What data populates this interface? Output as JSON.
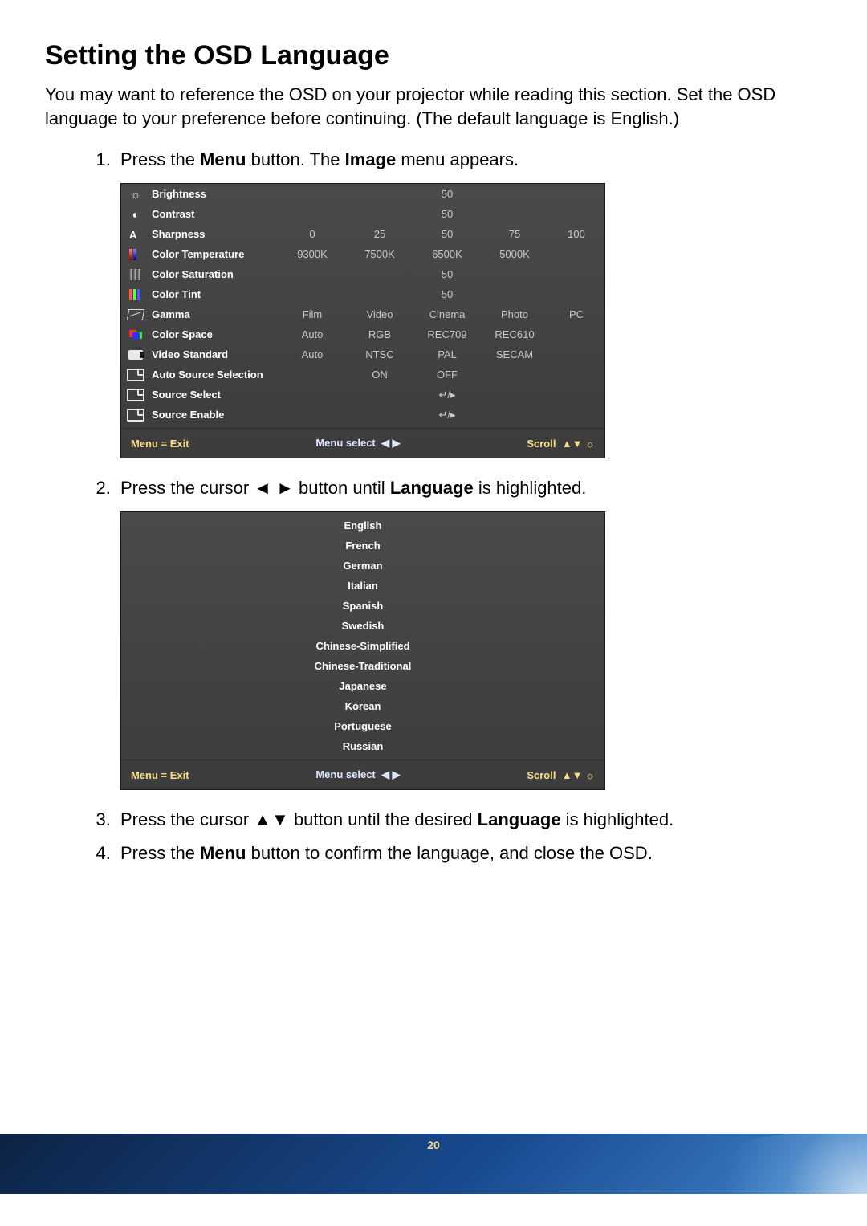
{
  "title": "Setting the OSD Language",
  "intro": "You may want to reference the OSD on your projector while reading this section. Set the OSD language to your preference before continuing. (The default language is English.)",
  "steps": {
    "s1_pre": "Press the ",
    "s1_b1": "Menu",
    "s1_mid": " button. The ",
    "s1_b2": "Image",
    "s1_post": " menu appears.",
    "s2_pre": "Press the cursor ◄ ► button until ",
    "s2_b": "Language",
    "s2_post": " is highlighted.",
    "s3_pre": "Press the cursor ▲▼ button until the desired ",
    "s3_b": "Language",
    "s3_post": " is highlighted.",
    "s4_pre": "Press the ",
    "s4_b": "Menu",
    "s4_post": " button to confirm the language, and close the OSD."
  },
  "osd": {
    "footer_exit": "Menu = Exit",
    "footer_select": "Menu select",
    "footer_scroll": "Scroll",
    "rows": [
      {
        "label": "Brightness",
        "cols": [
          "",
          "",
          "50",
          "",
          ""
        ]
      },
      {
        "label": "Contrast",
        "cols": [
          "",
          "",
          "50",
          "",
          ""
        ]
      },
      {
        "label": "Sharpness",
        "cols": [
          "0",
          "25",
          "50",
          "75",
          "100"
        ]
      },
      {
        "label": "Color Temperature",
        "cols": [
          "9300K",
          "7500K",
          "6500K",
          "5000K",
          ""
        ]
      },
      {
        "label": "Color Saturation",
        "cols": [
          "",
          "",
          "50",
          "",
          ""
        ]
      },
      {
        "label": "Color Tint",
        "cols": [
          "",
          "",
          "50",
          "",
          ""
        ]
      },
      {
        "label": "Gamma",
        "cols": [
          "Film",
          "Video",
          "Cinema",
          "Photo",
          "PC"
        ]
      },
      {
        "label": "Color Space",
        "cols": [
          "Auto",
          "RGB",
          "REC709",
          "REC610",
          ""
        ]
      },
      {
        "label": "Video Standard",
        "cols": [
          "Auto",
          "NTSC",
          "PAL",
          "SECAM",
          ""
        ]
      },
      {
        "label": "Auto Source Selection",
        "cols": [
          "",
          "ON",
          "OFF",
          "",
          ""
        ]
      },
      {
        "label": "Source Select",
        "cols": [
          "",
          "",
          "↵/▸",
          "",
          ""
        ]
      },
      {
        "label": "Source Enable",
        "cols": [
          "",
          "",
          "↵/▸",
          "",
          ""
        ]
      }
    ]
  },
  "languages": [
    "English",
    "French",
    "German",
    "Italian",
    "Spanish",
    "Swedish",
    "Chinese-Simplified",
    "Chinese-Traditional",
    "Japanese",
    "Korean",
    "Portuguese",
    "Russian"
  ],
  "page_number": "20"
}
